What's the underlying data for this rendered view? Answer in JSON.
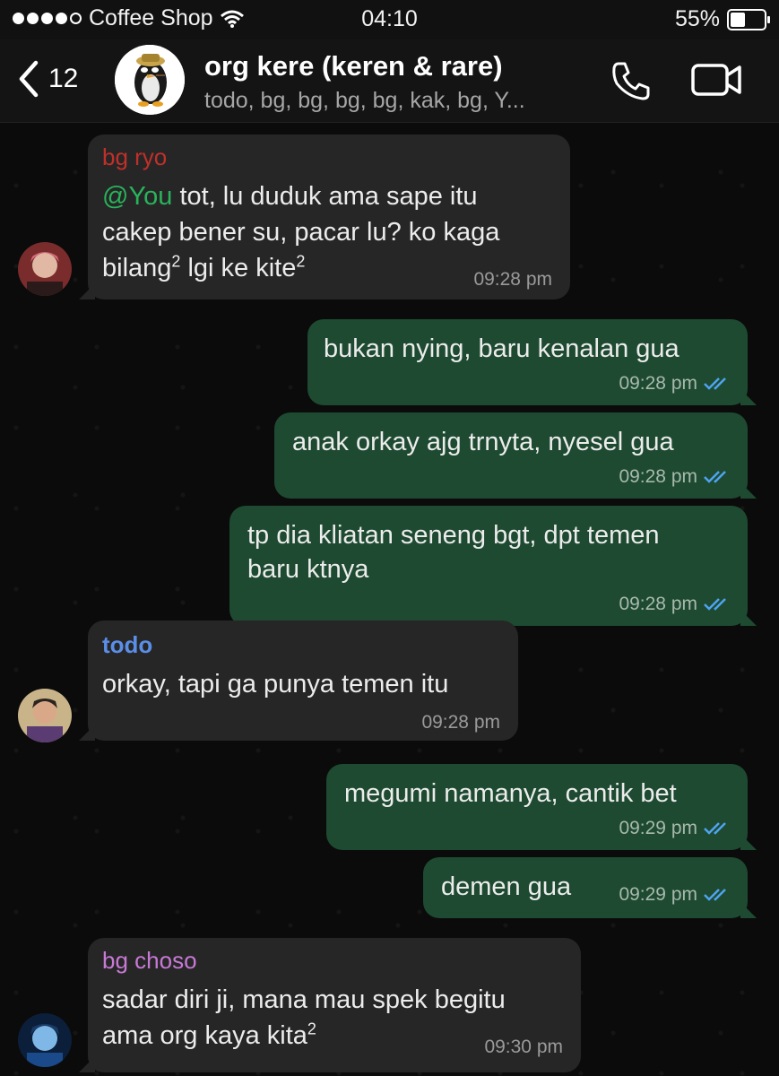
{
  "status_bar": {
    "carrier": "Coffee Shop",
    "time": "04:10",
    "battery": "55%",
    "battery_level": 0.55
  },
  "header": {
    "back_count": "12",
    "group_name": "org kere (keren & rare)",
    "members": "todo, bg, bg, bg, bg, kak, bg, Y..."
  },
  "colors": {
    "sender_bg_ryo": "#c0302a",
    "sender_todo": "#5b8ee6",
    "sender_bg_choso": "#c879d6",
    "mention": "#29b35b",
    "tick": "#4fa3f0"
  },
  "messages": [
    {
      "direction": "in",
      "sender": "bg ryo",
      "mention": "@You",
      "text_after_mention": " tot, lu duduk ama sape itu",
      "line2": "cakep bener su, pacar lu? ko kaga",
      "line3_a": "bilang",
      "line3_sup1": "2",
      "line3_b": " lgi ke kite",
      "line3_sup2": "2",
      "time": "09:28 pm"
    },
    {
      "direction": "out",
      "text": "bukan nying, baru kenalan gua",
      "time": "09:28 pm"
    },
    {
      "direction": "out",
      "text": "anak orkay ajg trnyta, nyesel gua",
      "time": "09:28 pm"
    },
    {
      "direction": "out",
      "line1": "tp dia kliatan seneng bgt, dpt temen",
      "line2": "baru ktnya",
      "time": "09:28 pm"
    },
    {
      "direction": "in",
      "sender": "todo",
      "text": "orkay, tapi ga punya temen itu",
      "time": "09:28 pm"
    },
    {
      "direction": "out",
      "text": "megumi namanya, cantik bet",
      "time": "09:29 pm"
    },
    {
      "direction": "out",
      "text": "demen gua",
      "time": "09:29 pm"
    },
    {
      "direction": "in",
      "sender": "bg choso",
      "line1": "sadar diri ji, mana mau spek begitu",
      "line2_a": "ama org kaya kita",
      "line2_sup": "2",
      "time": "09:30 pm"
    }
  ]
}
